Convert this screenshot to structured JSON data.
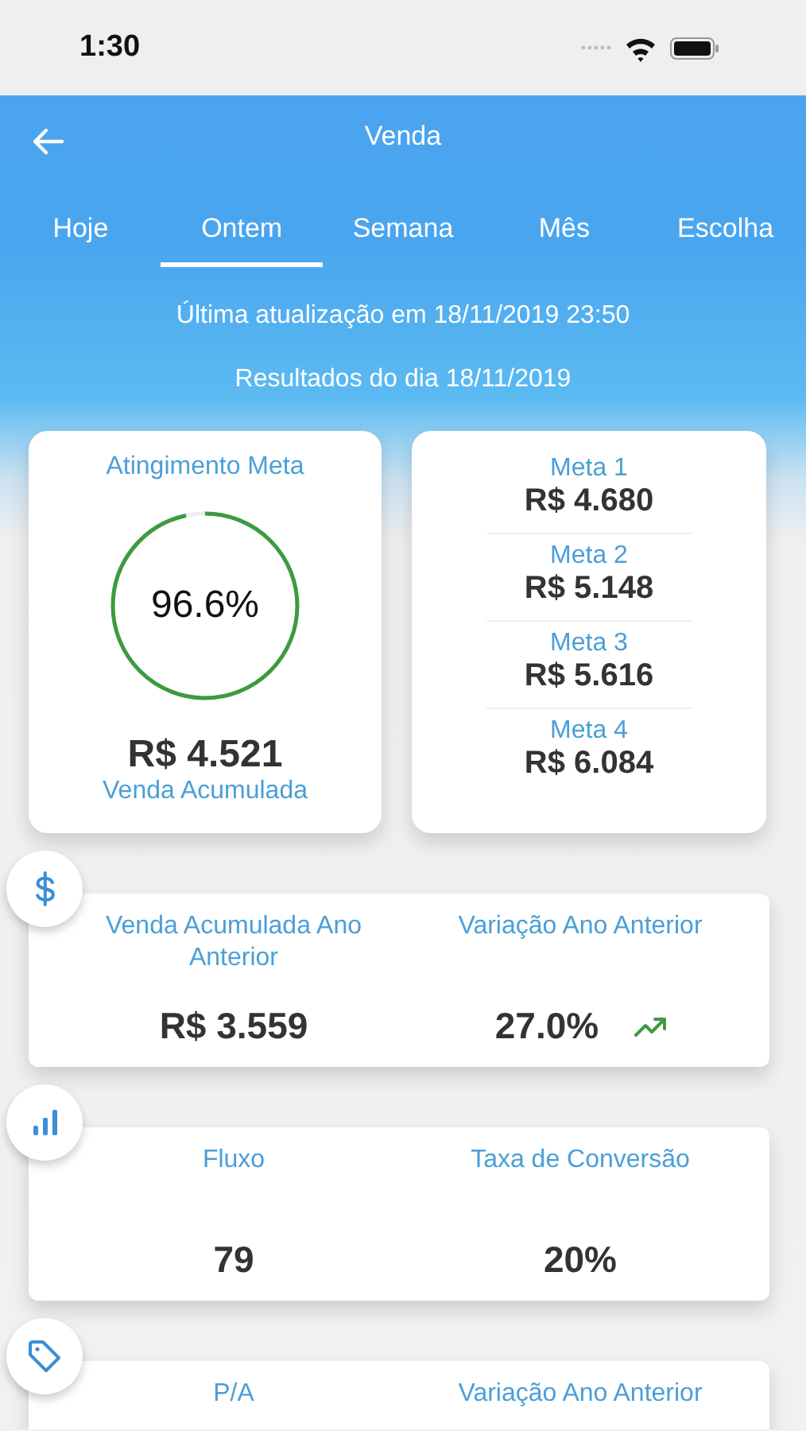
{
  "status_bar": {
    "time": "1:30"
  },
  "header": {
    "title": "Venda"
  },
  "tabs": [
    {
      "label": "Hoje",
      "selected": false
    },
    {
      "label": "Ontem",
      "selected": true
    },
    {
      "label": "Semana",
      "selected": false
    },
    {
      "label": "Mês",
      "selected": false
    },
    {
      "label": "Escolha",
      "selected": false
    }
  ],
  "last_update": "Última atualização em 18/11/2019 23:50",
  "results_date": "Resultados do dia 18/11/2019",
  "goal_card": {
    "title": "Atingimento Meta",
    "level": 0.966,
    "percent": "96.6%",
    "amount": "R$ 4.521",
    "caption": "Venda Acumulada"
  },
  "goals": [
    {
      "label": "Meta 1",
      "value": "R$ 4.680"
    },
    {
      "label": "Meta 2",
      "value": "R$ 5.148"
    },
    {
      "label": "Meta 3",
      "value": "R$ 5.616"
    },
    {
      "label": "Meta 4",
      "value": "R$ 6.084"
    }
  ],
  "sections": [
    {
      "kind": "money",
      "metrics": [
        {
          "label": "Venda Acumulada Ano Anterior",
          "value": "R$ 3.559",
          "trend_up": false
        },
        {
          "label": "Variação Ano Anterior",
          "value": "27.0%",
          "trend_up": true
        }
      ]
    },
    {
      "kind": "chart",
      "metrics": [
        {
          "label": "Fluxo",
          "value": "79",
          "trend_up": false
        },
        {
          "label": "Taxa de Conversão",
          "value": "20%",
          "trend_up": false
        }
      ]
    },
    {
      "kind": "tag",
      "metrics": [
        {
          "label": "P/A"
        },
        {
          "label": "Variação Ano Anterior"
        }
      ]
    }
  ]
}
